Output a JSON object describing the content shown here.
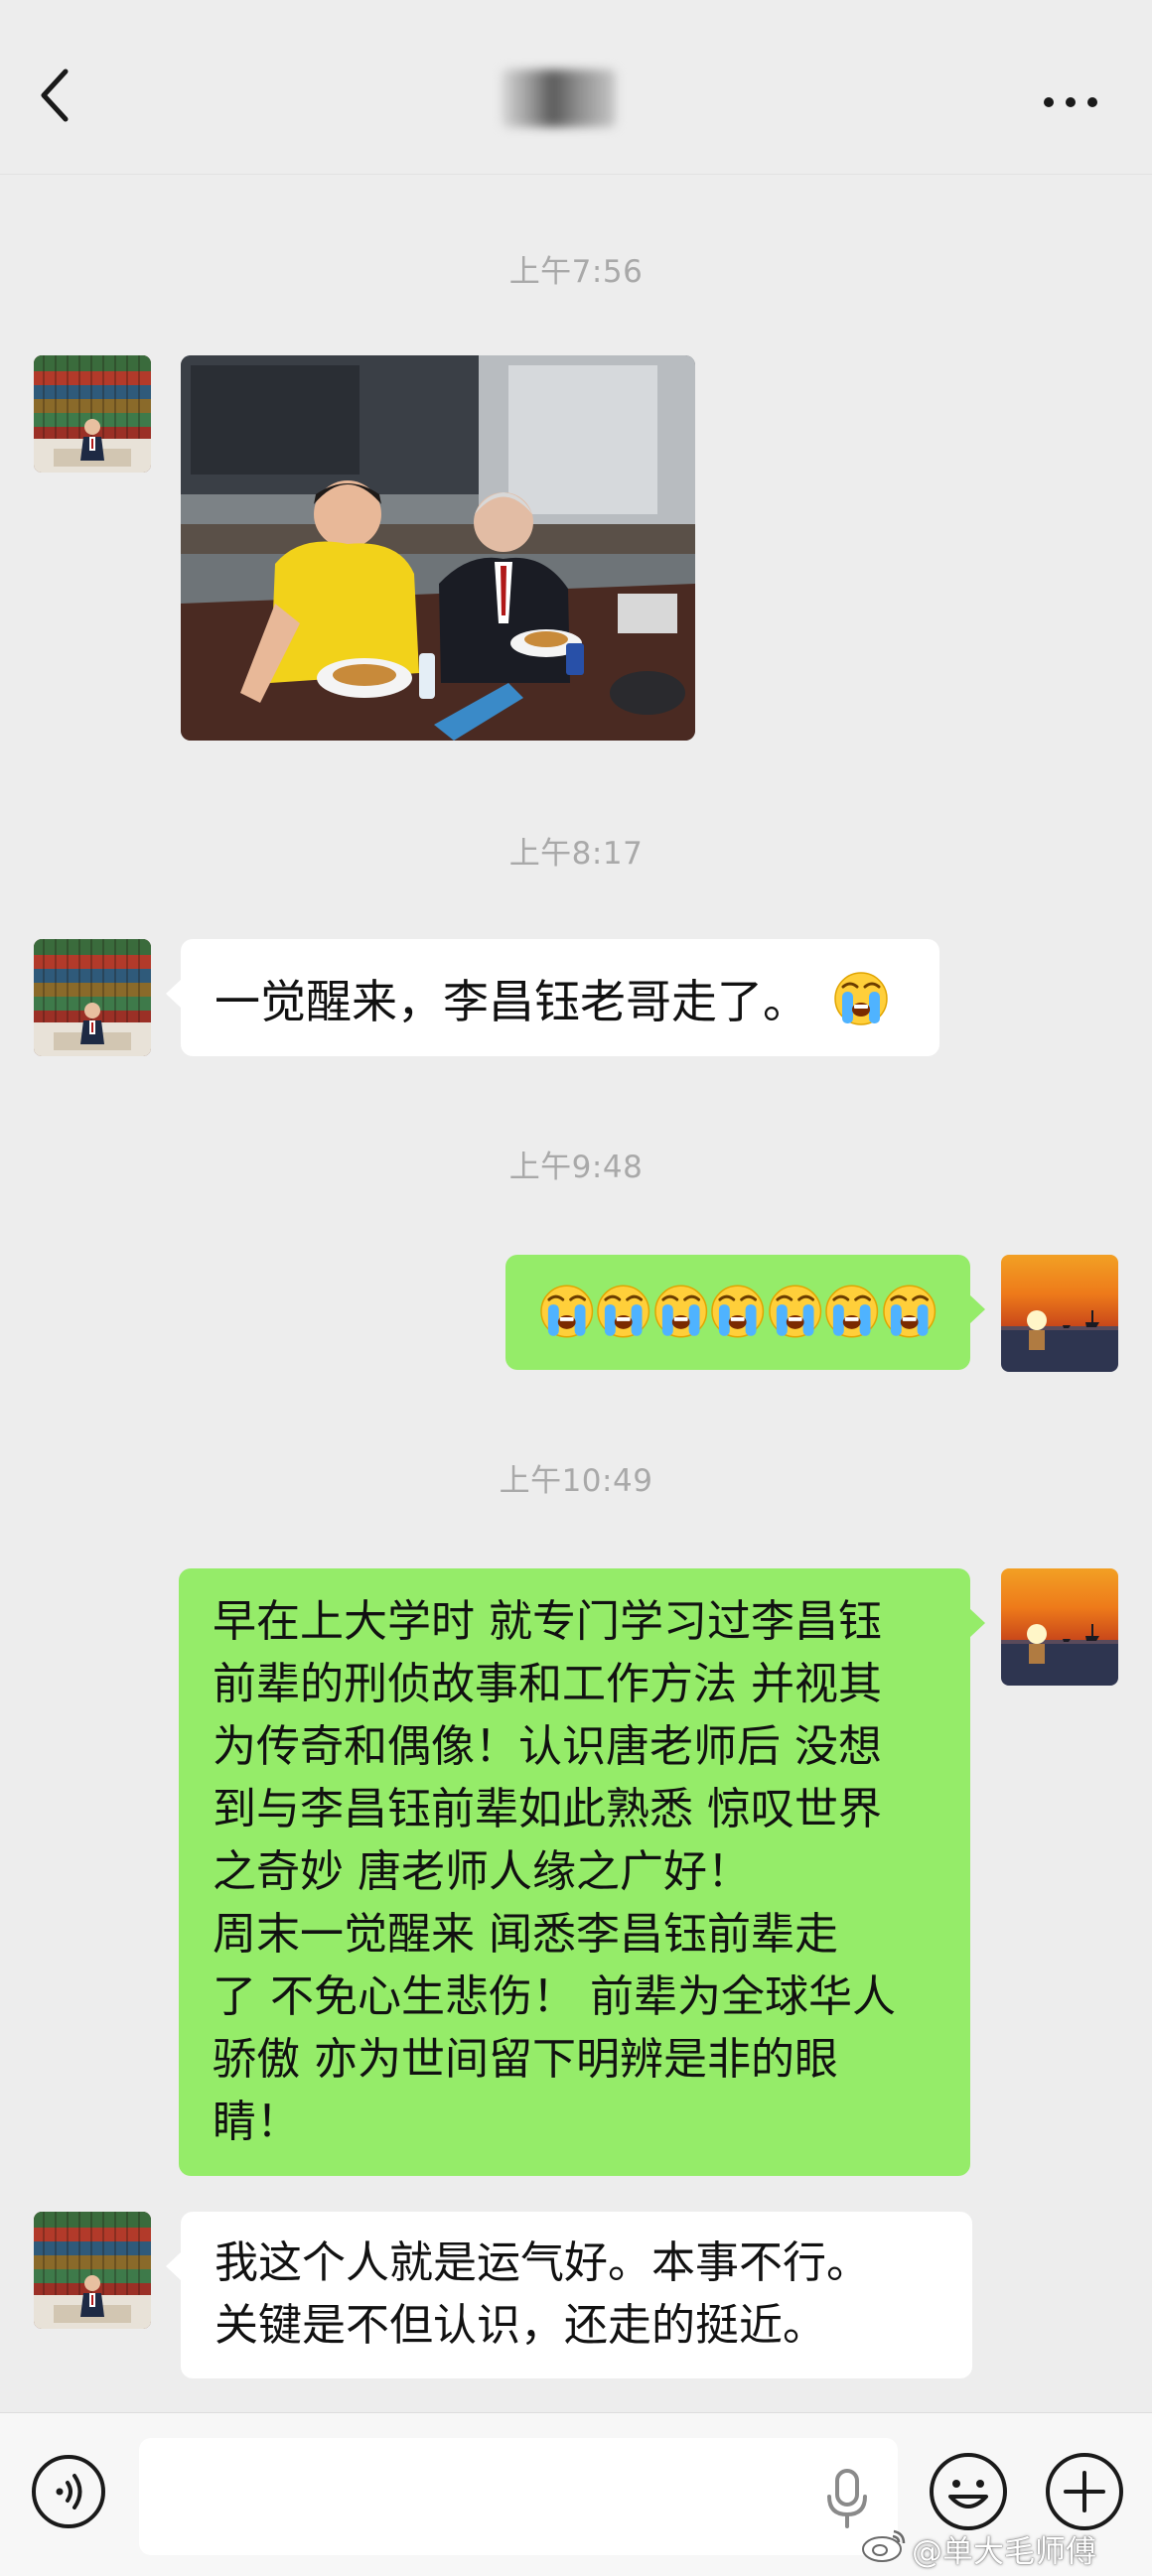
{
  "header": {
    "title": "",
    "back_icon": "chevron-left-icon",
    "more_icon": "more-dots-icon"
  },
  "messages": [
    {
      "time": "上午7:56"
    },
    {
      "time": "上午8:17",
      "text": "一觉醒来，李昌钰老哥走了。"
    },
    {
      "time": "上午9:48",
      "emoji_count": 7
    },
    {
      "time": "上午10:49",
      "text": "早在上大学时 就专门学习过李昌钰\n前辈的刑侦故事和工作方法 并视其\n为传奇和偶像！认识唐老师后 没想\n到与李昌钰前辈如此熟悉 惊叹世界\n之奇妙 唐老师人缘之广好！\n周末一觉醒来 闻悉李昌钰前辈走\n了 不免心生悲伤！ 前辈为全球华人\n骄傲 亦为世间留下明辨是非的眼\n睛！"
    },
    {
      "text": "我这个人就是运气好。本事不行。\n关键是不但认识，还走的挺近。"
    }
  ],
  "input_bar": {
    "placeholder": "",
    "value": ""
  },
  "watermark": "@单大毛师傅",
  "colors": {
    "background": "#ededed",
    "bubble_left": "#ffffff",
    "bubble_right": "#95ec69",
    "time_text": "#a9a9a9"
  }
}
